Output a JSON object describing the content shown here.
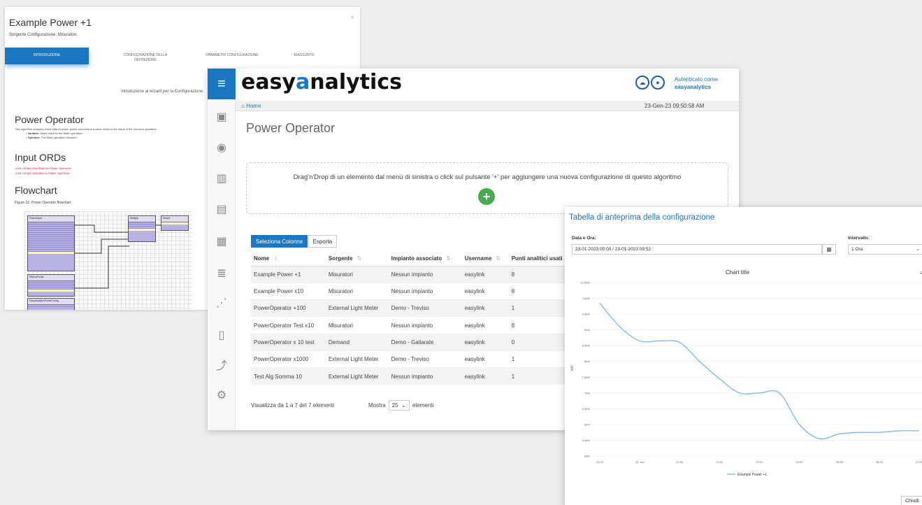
{
  "wizard": {
    "title": "Example Power +1",
    "subtitle": "Sorgente Configurazione: Misuratori",
    "close": "×",
    "steps": [
      {
        "line1": "INTRODUZIONE",
        "line2": ""
      },
      {
        "line1": "CONFIGURAZIONE DELLA",
        "line2": "DEFINIZIONE"
      },
      {
        "line1": "PARAMETRI CONFIGURAZIONE",
        "line2": ""
      },
      {
        "line1": "RIASSUNTO",
        "line2": ""
      }
    ],
    "intro": "Introduzione al wizard per la Configurazione",
    "doc": {
      "heading": "Power Operator",
      "description": "This algorithm analyzes trend data of power points and returns a value which is the result of the choosen operation.",
      "bullet1_key": "Variable:",
      "bullet1_val": " Value used for the Math operation.",
      "bullet2_key": "Operator:",
      "bullet2_val": " The Math operation choosen.",
      "inputs_heading": "Input ORDs",
      "ord1": "slot:/Algorithm/English/Power_Operator",
      "ord2": "slot:/Algorithm/Metric/Power_Operator",
      "flow_heading": "Flowchart",
      "figure_caption": "Figure 32.  Power Operator flowchart",
      "block_power_input": "PowerInput",
      "block_history": "HistoryPoints",
      "block_config": "EasyAnalyticsPowerConfig",
      "block_mult": "Multiply",
      "block_result": "Result"
    }
  },
  "app": {
    "logo_pre": "easy",
    "logo_accent": "a",
    "logo_post": "nalytics",
    "auth_line1": "Autenticato come",
    "auth_line2": "easyanalytics",
    "breadcrumb_home": "Home",
    "datetime": "23-Gen-23 09:50:58 AM",
    "page_title": "Power Operator",
    "dropzone_text": "Drag'n'Drop di un elemento dal menù di sinistra o click sul pulsante '+' per aggiungere una nuova configurazione di questo algoritmo",
    "add_label": "+",
    "btn_columns": "Seleziona Colonne",
    "btn_export": "Esporta",
    "columns": [
      "Nome",
      "Sorgente",
      "Impianto associato",
      "Username",
      "Punti analitici usati"
    ],
    "rows": [
      [
        "Example Power +1",
        "Misuratori",
        "Nessun impianto",
        "easylink",
        "8"
      ],
      [
        "Example Power x10",
        "Misuratori",
        "Nessun impianto",
        "easylink",
        "8"
      ],
      [
        "PowerOperator +100",
        "External Light Meter",
        "Demo - Treviso",
        "easylink",
        "1"
      ],
      [
        "PowerOperator Test x10",
        "Misuratori",
        "Nessun impianto",
        "easylink",
        "8"
      ],
      [
        "PowerOperator x 10 test",
        "Demand",
        "Demo - Gallarate",
        "easylink",
        "0"
      ],
      [
        "PowerOperator x1000",
        "External Light Meter",
        "Demo - Treviso",
        "easylink",
        "1"
      ],
      [
        "Test Alg Somma 10",
        "External Light Meter",
        "Nessun impianto",
        "easylink",
        "1"
      ]
    ],
    "info": "Visualizza da 1 a 7 del 7 elementi",
    "show_label": "Mostra",
    "page_length": "25",
    "elements_label": "elementi"
  },
  "preview": {
    "title": "Tabella di anteprima della configurazione",
    "date_label": "Data e Ora:",
    "date_value": "23-01-2023 00:00 / 23-01-2023 09:52",
    "interval_label": "Intervallo:",
    "interval_value": "1 Ora",
    "close_label": "Chiudi",
    "menu_icon": "≡",
    "calendar_icon": "▦"
  },
  "chart_data": {
    "type": "line",
    "title": "Chart title",
    "ylabel": "kW",
    "x_ticks": [
      "23:00",
      "23. Jan",
      "01:00",
      "02:00",
      "03:00",
      "04:00",
      "05:00",
      "06:00",
      "07:00"
    ],
    "y_ticks": [
      "5kW",
      "5.5kW",
      "6kW",
      "6.5kW",
      "7kW",
      "7.5kW",
      "8kW",
      "8.5kW",
      "9kW",
      "9.5kW",
      "10kW",
      "10.5kW"
    ],
    "ylim": [
      5,
      10.5
    ],
    "series": [
      {
        "name": "Example Power +1",
        "color": "#7cb5ec",
        "x": [
          0,
          0.5,
          1,
          1.5,
          2,
          2.5,
          3,
          3.5,
          4,
          4.5,
          5,
          5.5,
          6,
          6.5,
          7,
          7.5,
          8
        ],
        "y": [
          9.85,
          9.1,
          8.65,
          8.65,
          8.6,
          8.0,
          7.45,
          7.0,
          7.0,
          7.0,
          6.0,
          5.55,
          5.7,
          5.75,
          5.75,
          5.8,
          5.8
        ]
      }
    ]
  }
}
